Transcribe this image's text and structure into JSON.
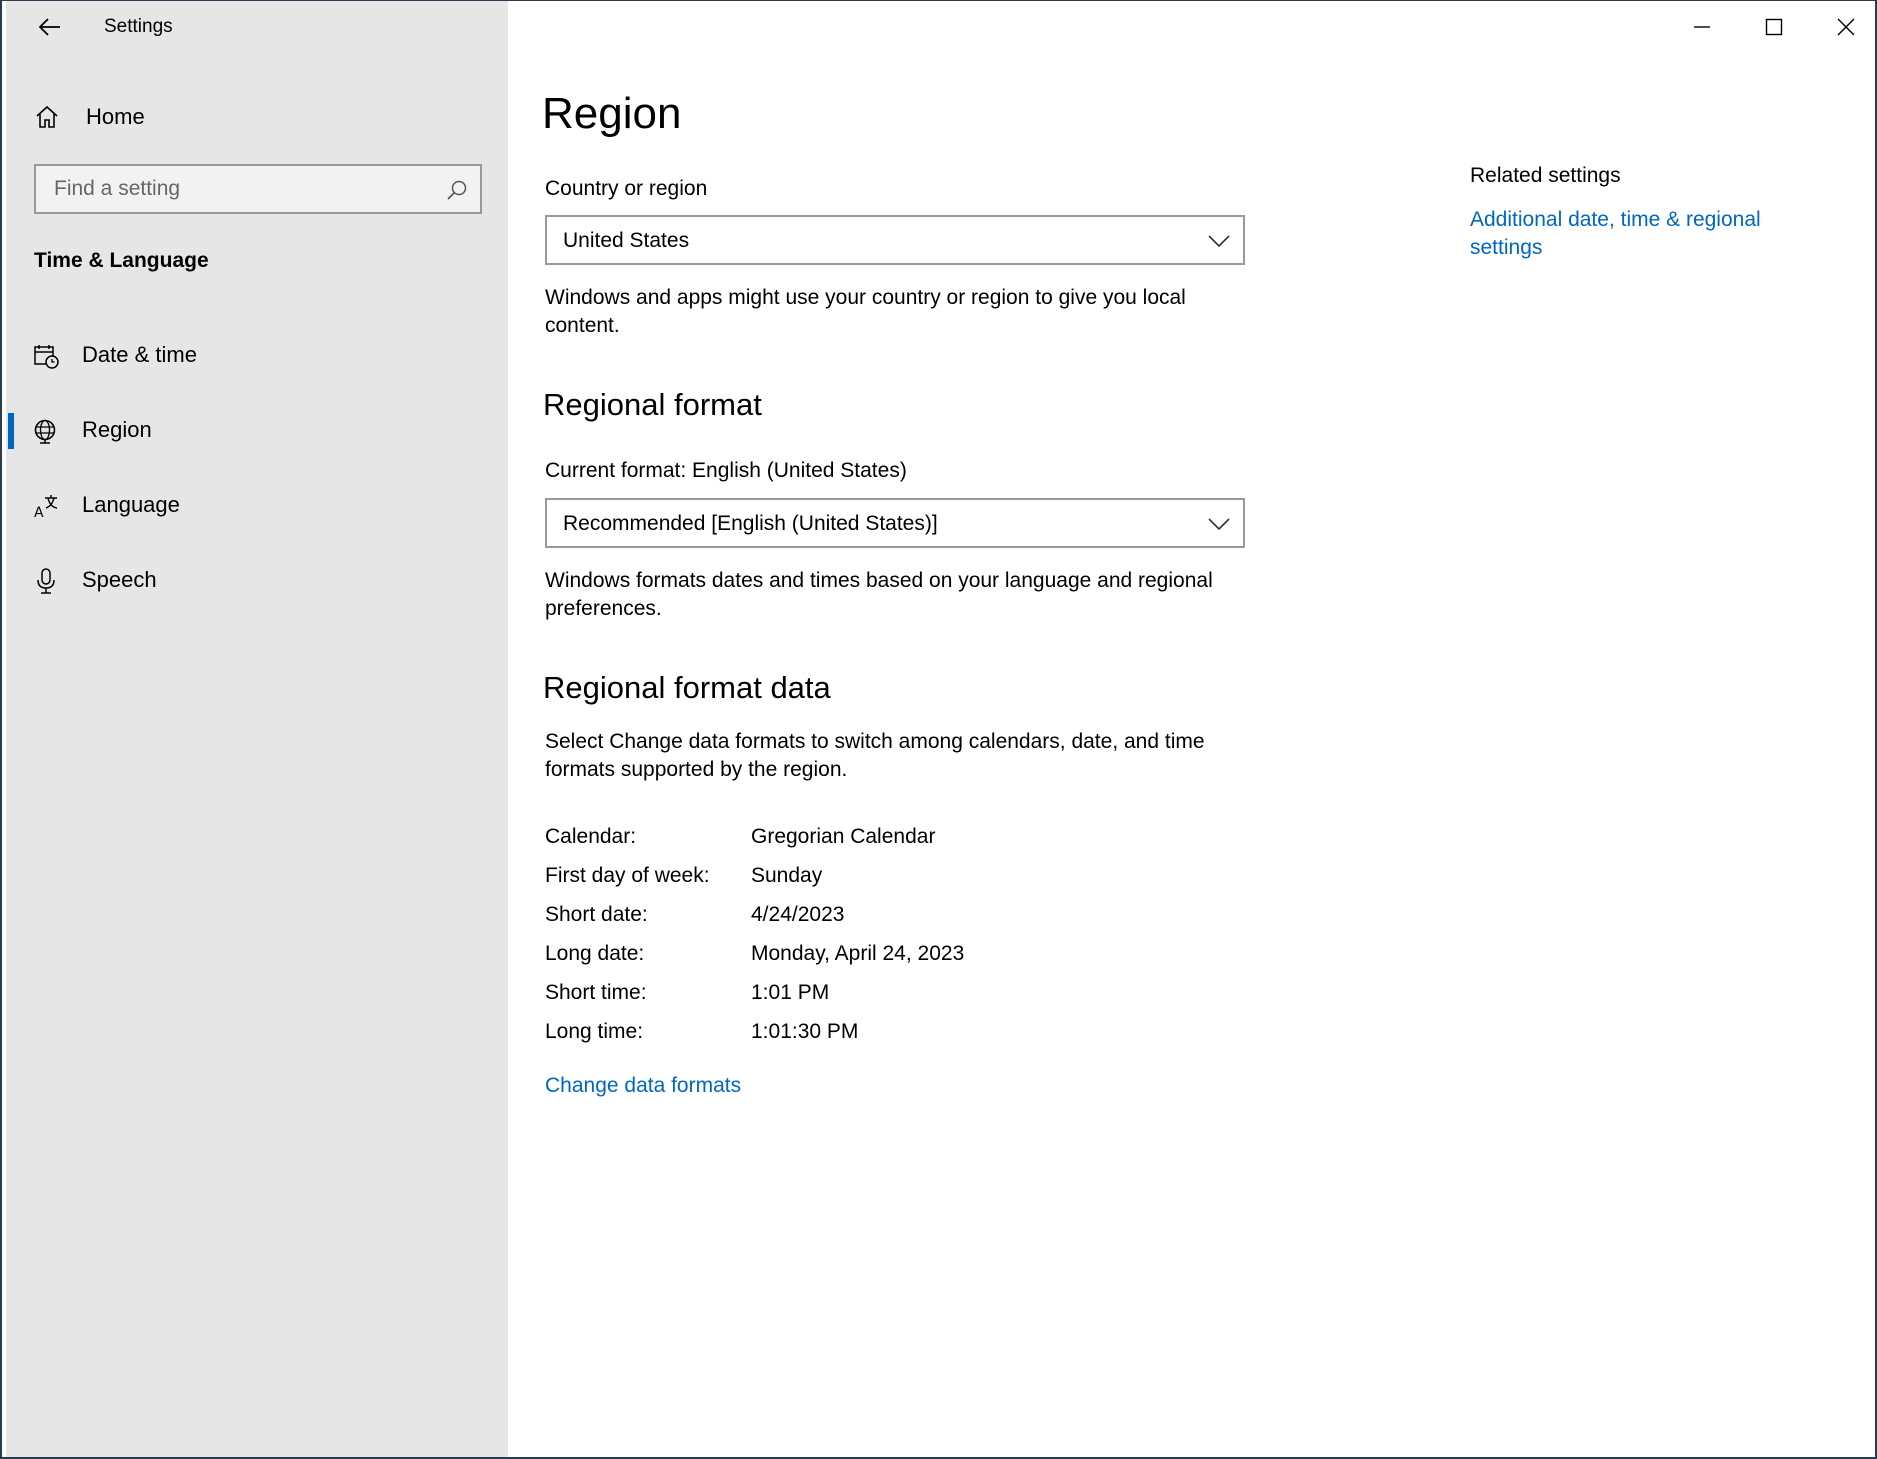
{
  "window": {
    "title": "Settings"
  },
  "sidebar": {
    "home_label": "Home",
    "search_placeholder": "Find a setting",
    "section_title": "Time & Language",
    "items": [
      {
        "label": "Date & time",
        "icon": "calendar-clock-icon"
      },
      {
        "label": "Region",
        "icon": "globe-icon",
        "selected": true
      },
      {
        "label": "Language",
        "icon": "language-icon"
      },
      {
        "label": "Speech",
        "icon": "microphone-icon"
      }
    ]
  },
  "main": {
    "title": "Region",
    "country": {
      "label": "Country or region",
      "value": "United States",
      "description": "Windows and apps might use your country or region to give you local content."
    },
    "regional_format": {
      "heading": "Regional format",
      "label": "Current format: English (United States)",
      "value": "Recommended [English (United States)]",
      "description": "Windows formats dates and times based on your language and regional preferences."
    },
    "format_data": {
      "heading": "Regional format data",
      "description": "Select Change data formats to switch among calendars, date, and time formats supported by the region.",
      "rows": [
        {
          "key": "Calendar:",
          "value": "Gregorian Calendar"
        },
        {
          "key": "First day of week:",
          "value": "Sunday"
        },
        {
          "key": "Short date:",
          "value": "4/24/2023"
        },
        {
          "key": "Long date:",
          "value": "Monday, April 24, 2023"
        },
        {
          "key": "Short time:",
          "value": "1:01 PM"
        },
        {
          "key": "Long time:",
          "value": "1:01:30 PM"
        }
      ],
      "change_link": "Change data formats"
    }
  },
  "related": {
    "heading": "Related settings",
    "link": "Additional date, time & regional settings"
  },
  "colors": {
    "accent": "#0067c0",
    "sidebar_bg": "#e6e6e6"
  }
}
